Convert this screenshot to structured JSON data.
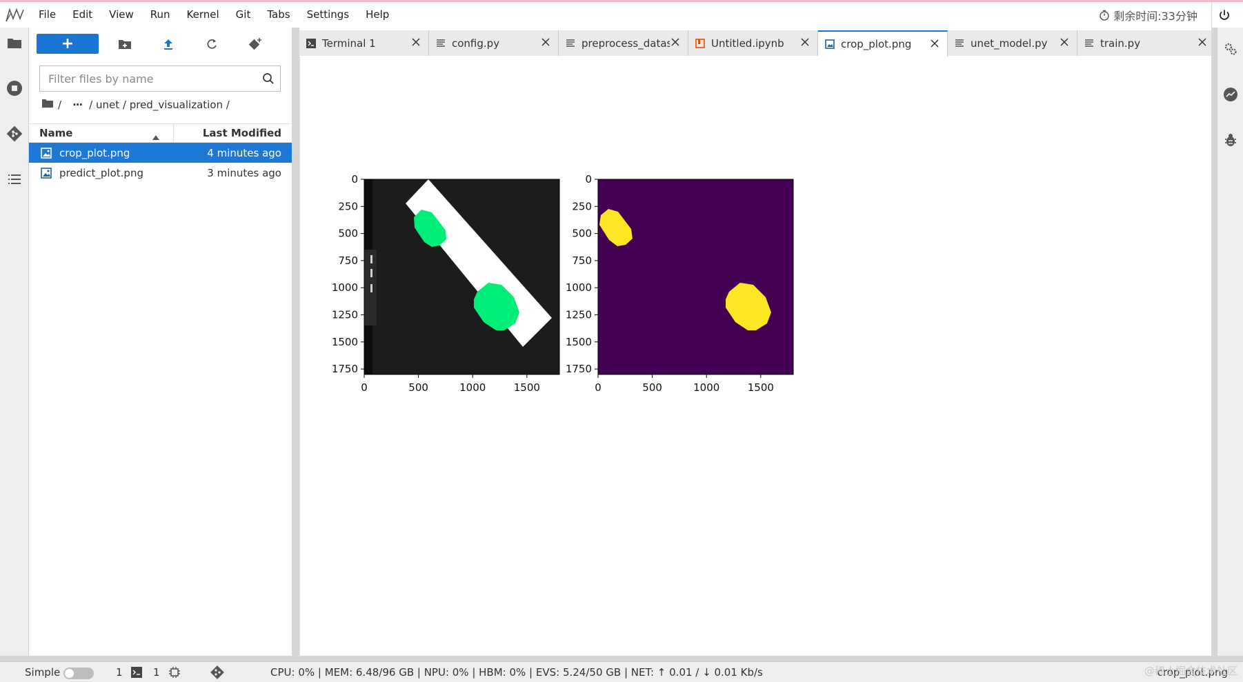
{
  "app": {
    "menu": [
      "File",
      "Edit",
      "View",
      "Run",
      "Kernel",
      "Git",
      "Tabs",
      "Settings",
      "Help"
    ],
    "timer": "剩余时间:33分钟"
  },
  "filebrowser": {
    "new_label": "+",
    "search_placeholder": "Filter files by name",
    "breadcrumb": {
      "root_sep": "/",
      "ellipsis": "···",
      "path": "/ unet / pred_visualization /"
    },
    "columns": {
      "name": "Name",
      "modified": "Last Modified"
    },
    "files": [
      {
        "name": "crop_plot.png",
        "modified": "4 minutes ago",
        "selected": true
      },
      {
        "name": "predict_plot.png",
        "modified": "3 minutes ago",
        "selected": false
      }
    ]
  },
  "tabs": [
    {
      "label": "Terminal 1",
      "icon": "terminal-icon",
      "active": false
    },
    {
      "label": "config.py",
      "icon": "file-text-icon",
      "active": false
    },
    {
      "label": "preprocess_datase",
      "icon": "file-text-icon",
      "active": false
    },
    {
      "label": "Untitled.ipynb",
      "icon": "notebook-icon",
      "active": false
    },
    {
      "label": "crop_plot.png",
      "icon": "image-icon",
      "active": true
    },
    {
      "label": "unet_model.py",
      "icon": "file-text-icon",
      "active": false
    },
    {
      "label": "train.py",
      "icon": "file-text-icon",
      "active": false
    }
  ],
  "plot": {
    "ytick_labels": [
      "0",
      "250",
      "500",
      "750",
      "1000",
      "1250",
      "1500",
      "1750"
    ],
    "xtick_labels": [
      "0",
      "500",
      "1000",
      "1500"
    ],
    "left_image": {
      "background": "#1c1c1c",
      "strip": "#ffffff",
      "blob": "#00ee77"
    },
    "right_image": {
      "background": "#440154",
      "blob": "#fde725"
    }
  },
  "chart_data": {
    "type": "heatmap",
    "panels": [
      {
        "image": "grayscale photo with green overlay",
        "xlim": [
          0,
          1800
        ],
        "ylim": [
          1800,
          0
        ]
      },
      {
        "image": "binary mask (viridis)",
        "xlim": [
          0,
          1800
        ],
        "ylim": [
          1800,
          0
        ]
      }
    ],
    "xticks": [
      0,
      500,
      1000,
      1500
    ],
    "yticks": [
      0,
      250,
      500,
      750,
      1000,
      1250,
      1500,
      1750
    ]
  },
  "statusbar": {
    "mode": "Simple",
    "kernels": "1",
    "terminals": "1",
    "metrics": "CPU:  0%  |  MEM:  6.48/96  GB  |  NPU:  0%  |  HBM:  0%  |  EVS:  5.24/50  GB  |  NET:  ↑  0.01   /  ↓  0.01   Kb/s",
    "file": "crop_plot.png"
  },
  "watermark": "@稀土掘金技术社区"
}
